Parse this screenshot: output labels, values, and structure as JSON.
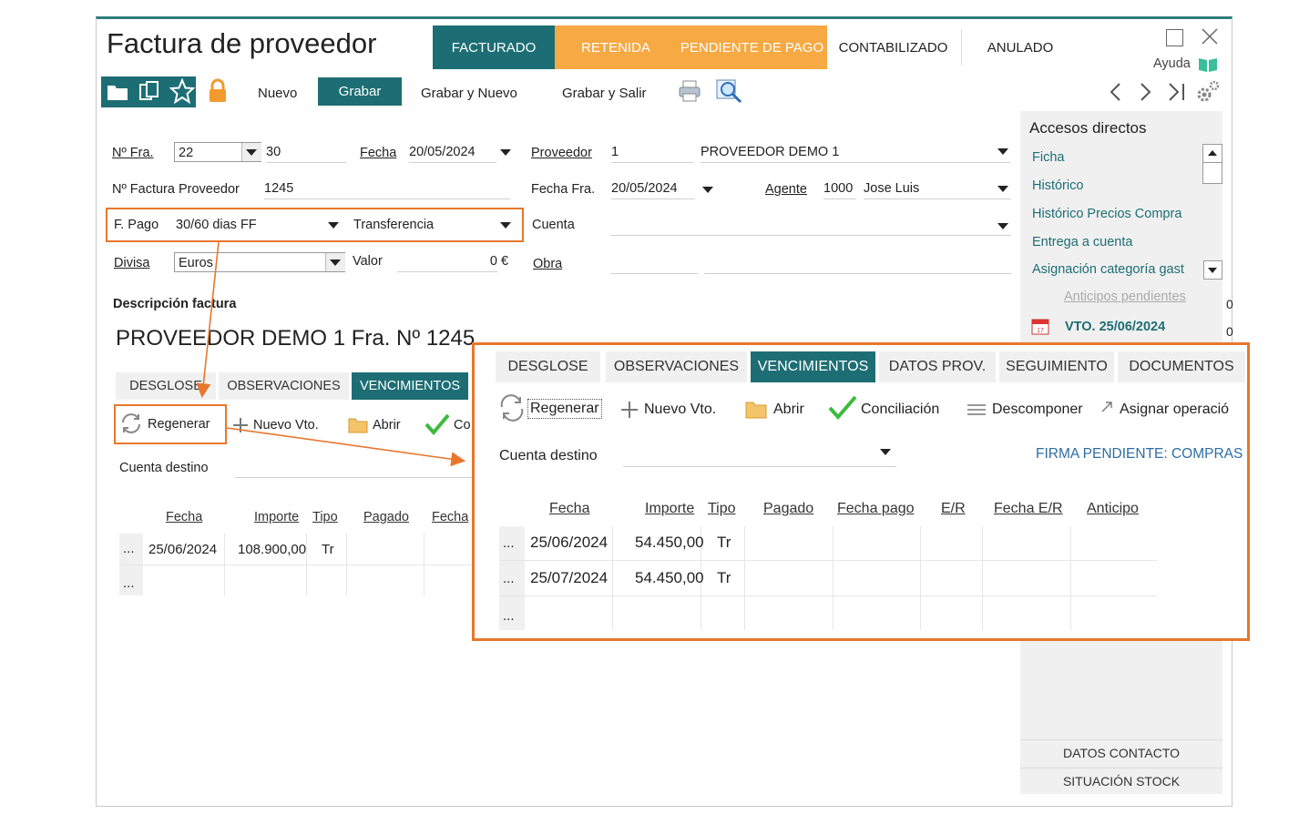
{
  "window": {
    "title": "Factura de proveedor",
    "help_label": "Ayuda"
  },
  "status_tabs": [
    {
      "label": "FACTURADO"
    },
    {
      "label": "RETENIDA"
    },
    {
      "label": "PENDIENTE DE PAGO"
    },
    {
      "label": "CONTABILIZADO"
    },
    {
      "label": "ANULADO"
    }
  ],
  "toolbar": {
    "nuevo": "Nuevo",
    "grabar": "Grabar",
    "grabar_nuevo": "Grabar y Nuevo",
    "grabar_salir": "Grabar y Salir"
  },
  "form": {
    "nfra_label": "Nº Fra.",
    "nfra_serie": "22",
    "nfra_num": "30",
    "fecha_label": "Fecha",
    "fecha_value": "20/05/2024",
    "proveedor_label": "Proveedor",
    "proveedor_code": "1",
    "proveedor_name": "PROVEEDOR DEMO 1",
    "nfact_prov_label": "Nº Factura Proveedor",
    "nfact_prov_value": "1245",
    "fecha_fra_label": "Fecha Fra.",
    "fecha_fra_value": "20/05/2024",
    "agente_label": "Agente",
    "agente_code": "1000",
    "agente_name": "Jose Luis",
    "fpago_label": "F. Pago",
    "fpago_value": "30/60 dias FF",
    "fpago_medio": "Transferencia",
    "cuenta_label": "Cuenta",
    "divisa_label": "Divisa",
    "divisa_value": "Euros",
    "valor_label": "Valor",
    "valor_value": "0",
    "valor_currency": "€",
    "obra_label": "Obra",
    "descripcion_label": "Descripción factura",
    "descripcion_value": "PROVEEDOR DEMO 1 Fra. Nº 1245"
  },
  "accesos": {
    "title": "Accesos directos",
    "items": [
      "Ficha",
      "Histórico",
      "Histórico Precios Compra",
      "Entrega a cuenta",
      "Asignación categoría gast"
    ],
    "disabled_item": "Anticipos pendientes",
    "vto": "VTO. 25/06/2024",
    "bottom_buttons": [
      "DATOS CONTACTO",
      "SITUACIÓN STOCK"
    ],
    "edge_digits": [
      "0",
      "0"
    ]
  },
  "bottom_tabs": [
    "DESGLOSE",
    "OBSERVACIONES",
    "VENCIMIENTOS"
  ],
  "actions": {
    "regenerar": "Regenerar",
    "nuevo_vto": "Nuevo Vto.",
    "abrir": "Abrir",
    "conciliacion_short": "Co"
  },
  "cuenta_destino_label": "Cuenta destino",
  "vencimientos_small": {
    "columns": [
      "Fecha",
      "Importe",
      "Tipo",
      "Pagado",
      "Fecha"
    ],
    "rows": [
      {
        "marker": "...",
        "fecha": "25/06/2024",
        "importe": "108.900,00",
        "tipo": "Tr"
      },
      {
        "marker": "...",
        "fecha": "",
        "importe": "",
        "tipo": ""
      }
    ]
  },
  "zoom": {
    "tabs": [
      "DESGLOSE",
      "OBSERVACIONES",
      "VENCIMIENTOS",
      "DATOS PROV.",
      "SEGUIMIENTO",
      "DOCUMENTOS"
    ],
    "actions": {
      "regenerar": "Regenerar",
      "nuevo_vto": "Nuevo Vto.",
      "abrir": "Abrir",
      "conciliacion": "Conciliación",
      "descomponer": "Descomponer",
      "asignar": "Asignar operació"
    },
    "cuenta_destino_label": "Cuenta destino",
    "firma": "FIRMA PENDIENTE: COMPRAS",
    "columns": [
      "Fecha",
      "Importe",
      "Tipo",
      "Pagado",
      "Fecha pago",
      "E/R",
      "Fecha E/R",
      "Anticipo"
    ],
    "rows": [
      {
        "marker": "...",
        "fecha": "25/06/2024",
        "importe": "54.450,00",
        "tipo": "Tr"
      },
      {
        "marker": "...",
        "fecha": "25/07/2024",
        "importe": "54.450,00",
        "tipo": "Tr"
      },
      {
        "marker": "...",
        "fecha": "",
        "importe": "",
        "tipo": ""
      }
    ]
  },
  "colors": {
    "accent": "#1d6e74",
    "orange": "#f7a943",
    "highlight": "#e8772d",
    "link": "#1d6e74"
  }
}
